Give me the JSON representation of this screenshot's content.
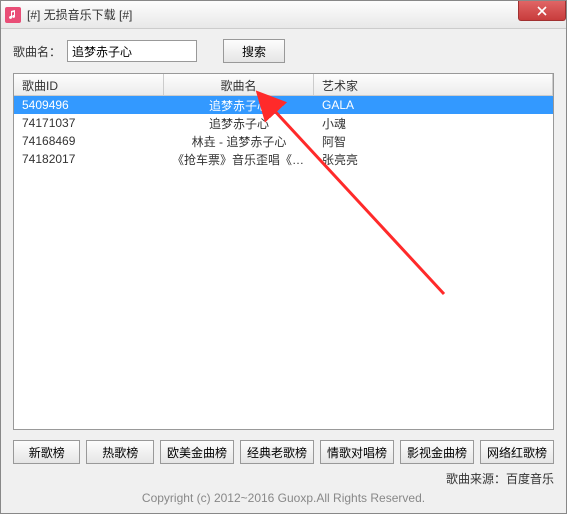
{
  "window": {
    "title": "[#] 无损音乐下载 [#]"
  },
  "search": {
    "label": "歌曲名：",
    "value": "追梦赤子心",
    "button": "搜索"
  },
  "table": {
    "headers": [
      "歌曲ID",
      "歌曲名",
      "艺术家"
    ],
    "rows": [
      {
        "id": "5409496",
        "name": "追梦赤子心",
        "artist": "GALA",
        "selected": true
      },
      {
        "id": "74171037",
        "name": "追梦赤子心",
        "artist": "小魂",
        "selected": false
      },
      {
        "id": "74168469",
        "name": "林垚 - 追梦赤子心",
        "artist": "阿智",
        "selected": false
      },
      {
        "id": "74182017",
        "name": "《抢车票》音乐歪唱《追梦赤子...",
        "artist": "张亮亮",
        "selected": false
      }
    ]
  },
  "bottom_buttons": [
    "新歌榜",
    "热歌榜",
    "欧美金曲榜",
    "经典老歌榜",
    "情歌对唱榜",
    "影视金曲榜",
    "网络红歌榜"
  ],
  "source": "歌曲来源：百度音乐",
  "copyright": "Copyright (c)  2012~2016 Guoxp.All Rights Reserved."
}
